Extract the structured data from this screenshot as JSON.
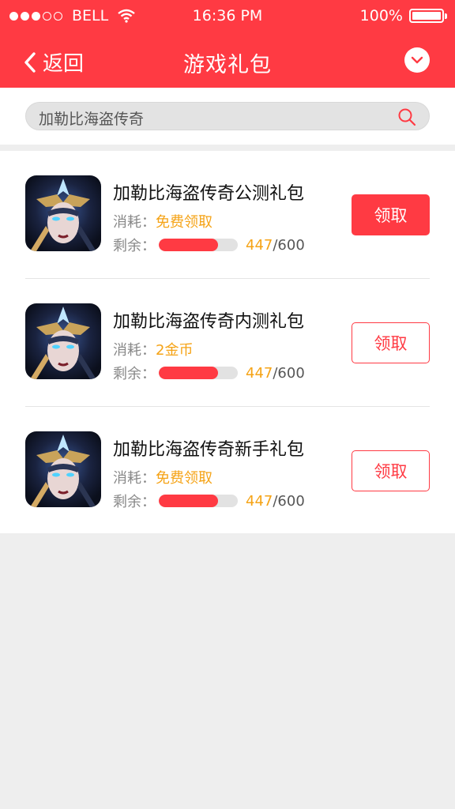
{
  "status_bar": {
    "carrier": "BELL",
    "time": "16:36 PM",
    "battery": "100%"
  },
  "nav": {
    "back_label": "返回",
    "title": "游戏礼包"
  },
  "search": {
    "value": "加勒比海盗传奇"
  },
  "labels": {
    "cost": "消耗：",
    "remain": "剩余："
  },
  "items": [
    {
      "name": "加勒比海盗传奇公测礼包",
      "cost": "免费领取",
      "remaining": "447",
      "total": "/600",
      "fraction": 0.745,
      "button": "领取",
      "style": "filled"
    },
    {
      "name": "加勒比海盗传奇内测礼包",
      "cost": "2金币",
      "remaining": "447",
      "total": "/600",
      "fraction": 0.745,
      "button": "领取",
      "style": "outline"
    },
    {
      "name": "加勒比海盗传奇新手礼包",
      "cost": "免费领取",
      "remaining": "447",
      "total": "/600",
      "fraction": 0.745,
      "button": "领取",
      "style": "outline"
    }
  ],
  "colors": {
    "accent": "#ff3a43",
    "highlight": "#f5a316",
    "background": "#eeeeee"
  },
  "icons": [
    "signal-dots-icon",
    "wifi-icon",
    "battery-icon",
    "chevron-left-icon",
    "chevron-down-icon",
    "search-icon"
  ]
}
